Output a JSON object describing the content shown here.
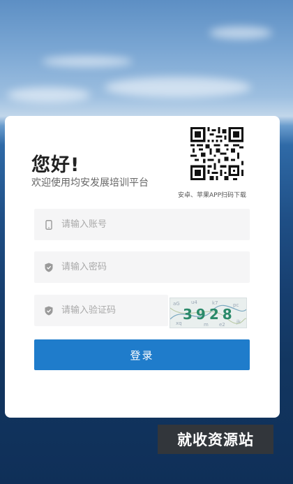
{
  "login": {
    "greeting": "您好!",
    "subtitle": "欢迎使用均安发展培训平台",
    "qr_caption": "安卓、苹果APP扫码下载",
    "account_placeholder": "请输入账号",
    "password_placeholder": "请输入密码",
    "captcha_placeholder": "请输入验证码",
    "captcha_text": "3928",
    "login_button": "登录"
  },
  "watermark": {
    "text": "就收资源站"
  },
  "colors": {
    "primary": "#1f7ccb",
    "card": "#ffffff",
    "input_bg": "#f5f5f6"
  },
  "icons": {
    "account": "phone-icon",
    "password": "shield-icon",
    "captcha": "shield-icon"
  }
}
